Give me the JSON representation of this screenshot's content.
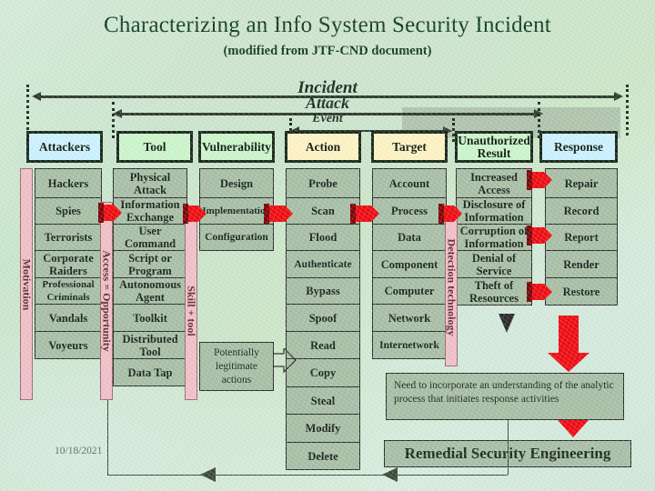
{
  "title": "Characterizing an Info System Security Incident",
  "subtitle": "(modified from JTF-CND document)",
  "spans": {
    "incident": "Incident",
    "attack": "Attack",
    "event": "Event"
  },
  "headers": [
    {
      "label": "Attackers",
      "color": "#ccf2ff"
    },
    {
      "label": "Tool",
      "color": "#ccf5cc"
    },
    {
      "label": "Vulnerability",
      "color": "#ccf5cc"
    },
    {
      "label": "Action",
      "color": "#fdf3c4"
    },
    {
      "label": "Target",
      "color": "#fdf3c4"
    },
    {
      "label": "Unauthorized Result",
      "color": "#ccf5cc"
    },
    {
      "label": "Response",
      "color": "#ccf2ff"
    }
  ],
  "columns": {
    "attackers": [
      "Hackers",
      "Spies",
      "Terrorists",
      "Corporate Raiders",
      "Professional Criminals",
      "Vandals",
      "Voyeurs"
    ],
    "tool": [
      "Physical Attack",
      "Information Exchange",
      "User Command",
      "Script or Program",
      "Autonomous Agent",
      "Toolkit",
      "Distributed Tool",
      "Data Tap"
    ],
    "vulnerability": [
      "Design",
      "Implementation",
      "Configuration"
    ],
    "action": [
      "Probe",
      "Scan",
      "Flood",
      "Authenticate",
      "Bypass",
      "Spoof",
      "Read",
      "Copy",
      "Steal",
      "Modify",
      "Delete"
    ],
    "target": [
      "Account",
      "Process",
      "Data",
      "Component",
      "Computer",
      "Network",
      "Internetwork"
    ],
    "unauthorized_result": [
      "Increased Access",
      "Disclosure of Information",
      "Corruption of Information",
      "Denial of Service",
      "Theft of Resources"
    ],
    "response": [
      "Repair",
      "Record",
      "Report",
      "Render",
      "Restore"
    ]
  },
  "vertical_bars": [
    {
      "label": "Motivation"
    },
    {
      "label": "Access = Opportunity"
    },
    {
      "label": "Skill + tool"
    },
    {
      "label": "Detection technology"
    }
  ],
  "legit_box": "Potentially legitimate actions",
  "note_box": "Need to incorporate an understanding of the analytic process that initiates response activities",
  "remedial": "Remedial Security Engineering",
  "date": "10/18/2021",
  "colors": {
    "cell_fill": "#a8bfa6",
    "vbar_fill": "#f0c0c8",
    "accent_red": "#ee0d12",
    "title_green": "#123d22"
  }
}
